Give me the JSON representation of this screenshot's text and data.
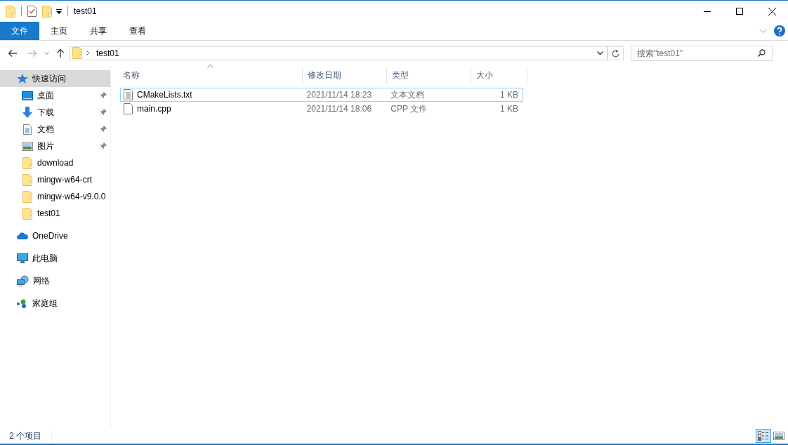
{
  "window": {
    "title": "test01"
  },
  "ribbon_tabs": [
    {
      "label": "文件",
      "kind": "file"
    },
    {
      "label": "主页",
      "kind": "tab"
    },
    {
      "label": "共享",
      "kind": "tab"
    },
    {
      "label": "查看",
      "kind": "tab"
    }
  ],
  "address": {
    "path": [
      "test01"
    ]
  },
  "search": {
    "placeholder": "搜索\"test01\""
  },
  "sidebar": [
    {
      "label": "快速访问",
      "kind": "quick",
      "selected": true,
      "children": [
        {
          "label": "桌面",
          "kind": "desktop",
          "pinned": true
        },
        {
          "label": "下载",
          "kind": "downloads",
          "pinned": true
        },
        {
          "label": "文档",
          "kind": "documents",
          "pinned": true
        },
        {
          "label": "图片",
          "kind": "pictures",
          "pinned": true
        },
        {
          "label": "download",
          "kind": "folder",
          "pinned": false
        },
        {
          "label": "mingw-w64-crt",
          "kind": "folder",
          "pinned": false
        },
        {
          "label": "mingw-w64-v9.0.0",
          "kind": "folder",
          "pinned": false
        },
        {
          "label": "test01",
          "kind": "folder",
          "pinned": false
        }
      ]
    },
    {
      "label": "OneDrive",
      "kind": "onedrive",
      "selected": false
    },
    {
      "label": "此电脑",
      "kind": "pc",
      "selected": false
    },
    {
      "label": "网络",
      "kind": "network",
      "selected": false
    },
    {
      "label": "家庭组",
      "kind": "homegroup",
      "selected": false
    }
  ],
  "table": {
    "columns": [
      {
        "label": "名称",
        "sorted": true
      },
      {
        "label": "修改日期",
        "sorted": false
      },
      {
        "label": "类型",
        "sorted": false
      },
      {
        "label": "大小",
        "sorted": false
      }
    ],
    "rows": [
      {
        "name": "CMakeLists.txt",
        "kind": "text",
        "modified": "2021/11/14 18:23",
        "type": "文本文档",
        "size": "1 KB",
        "focused": true
      },
      {
        "name": "main.cpp",
        "kind": "file",
        "modified": "2021/11/14 18:06",
        "type": "CPP 文件",
        "size": "1 KB",
        "focused": false
      }
    ]
  },
  "status_bar": {
    "count": "2 个项目",
    "views": [
      {
        "kind": "details",
        "selected": true
      },
      {
        "kind": "large-icons",
        "selected": false
      }
    ]
  }
}
